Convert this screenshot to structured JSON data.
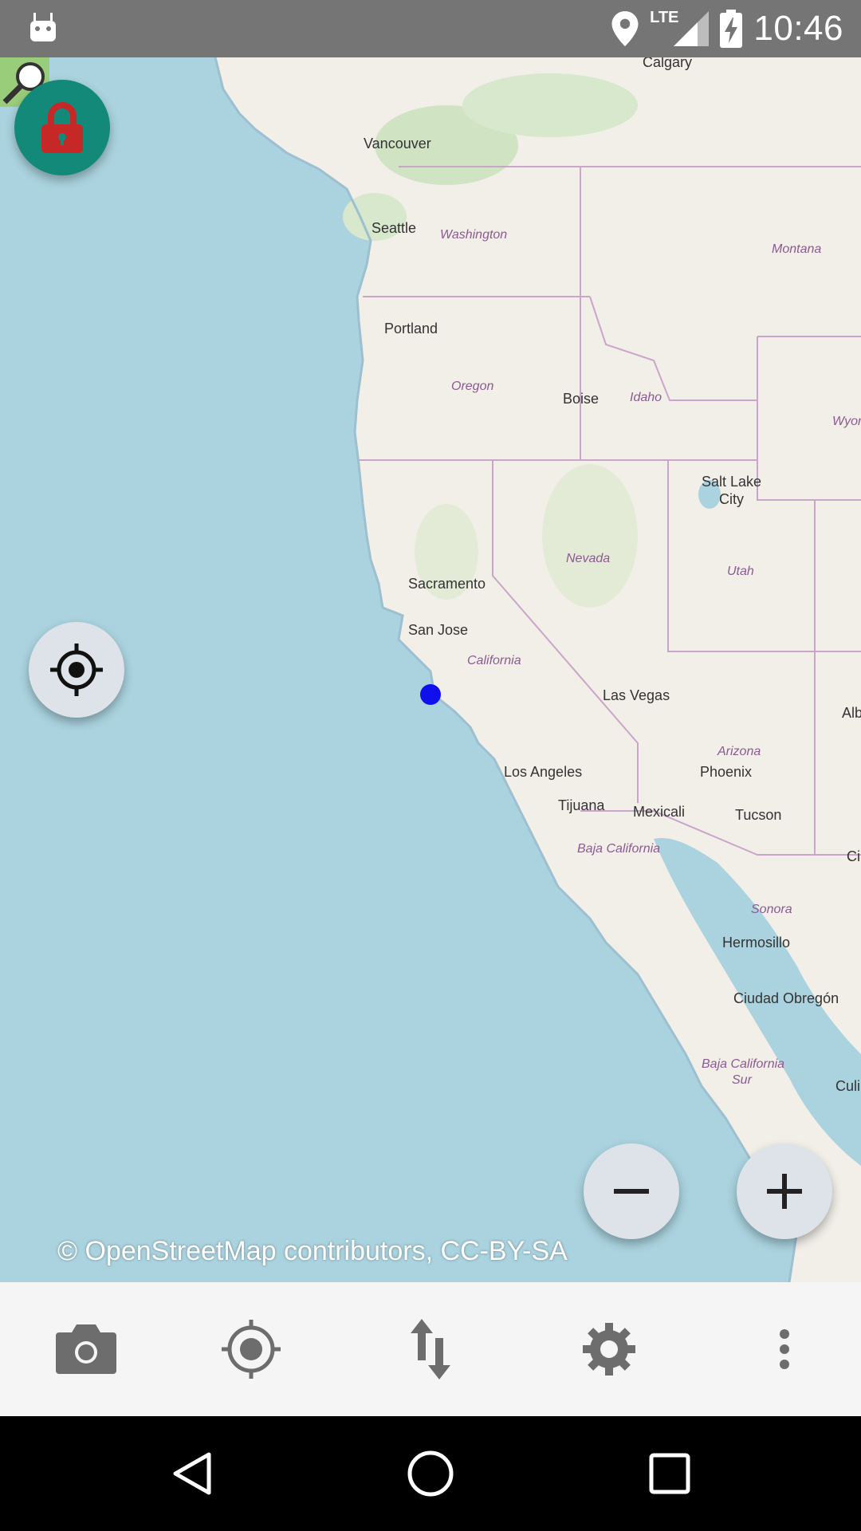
{
  "status_bar": {
    "time": "10:46",
    "network": "LTE",
    "icons": [
      "android-icon",
      "location-icon",
      "signal-icon",
      "battery-charging-icon"
    ]
  },
  "map": {
    "cities": [
      {
        "name": "Calgary"
      },
      {
        "name": "Vancouver"
      },
      {
        "name": "Seattle"
      },
      {
        "name": "Portland"
      },
      {
        "name": "Boise"
      },
      {
        "name": "Salt Lake"
      },
      {
        "name": "City"
      },
      {
        "name": "Sacramento"
      },
      {
        "name": "San Jose"
      },
      {
        "name": "Las Vegas"
      },
      {
        "name": "Los Angeles"
      },
      {
        "name": "Phoenix"
      },
      {
        "name": "Tijuana"
      },
      {
        "name": "Mexicali"
      },
      {
        "name": "Tucson"
      },
      {
        "name": "Hermosillo"
      },
      {
        "name": "Ciudad Obregón"
      },
      {
        "name": "Alb"
      },
      {
        "name": "Ci"
      },
      {
        "name": "Culi"
      }
    ],
    "regions": [
      {
        "name": "Washington"
      },
      {
        "name": "Montana"
      },
      {
        "name": "Oregon"
      },
      {
        "name": "Idaho"
      },
      {
        "name": "Wyon"
      },
      {
        "name": "Nevada"
      },
      {
        "name": "Utah"
      },
      {
        "name": "California"
      },
      {
        "name": "Arizona"
      },
      {
        "name": "Baja California"
      },
      {
        "name": "Sonora"
      },
      {
        "name": "Baja California"
      },
      {
        "name": "Sur"
      }
    ],
    "attribution": "© OpenStreetMap contributors, CC-BY-SA",
    "colors": {
      "water": "#aad3df",
      "land": "#f2efe9",
      "border": "#c9a0c9",
      "user_dot": "#1010ee"
    }
  },
  "controls": {
    "lock": "lock-icon",
    "locate": "crosshair-icon",
    "zoom_out": "minus-icon",
    "zoom_in": "plus-icon"
  },
  "toolbar": {
    "items": [
      "camera-icon",
      "gps-target-icon",
      "sort-arrows-icon",
      "settings-gear-icon",
      "more-vert-icon"
    ]
  },
  "nav_bar": {
    "items": [
      "back-icon",
      "home-icon",
      "recents-icon"
    ]
  }
}
